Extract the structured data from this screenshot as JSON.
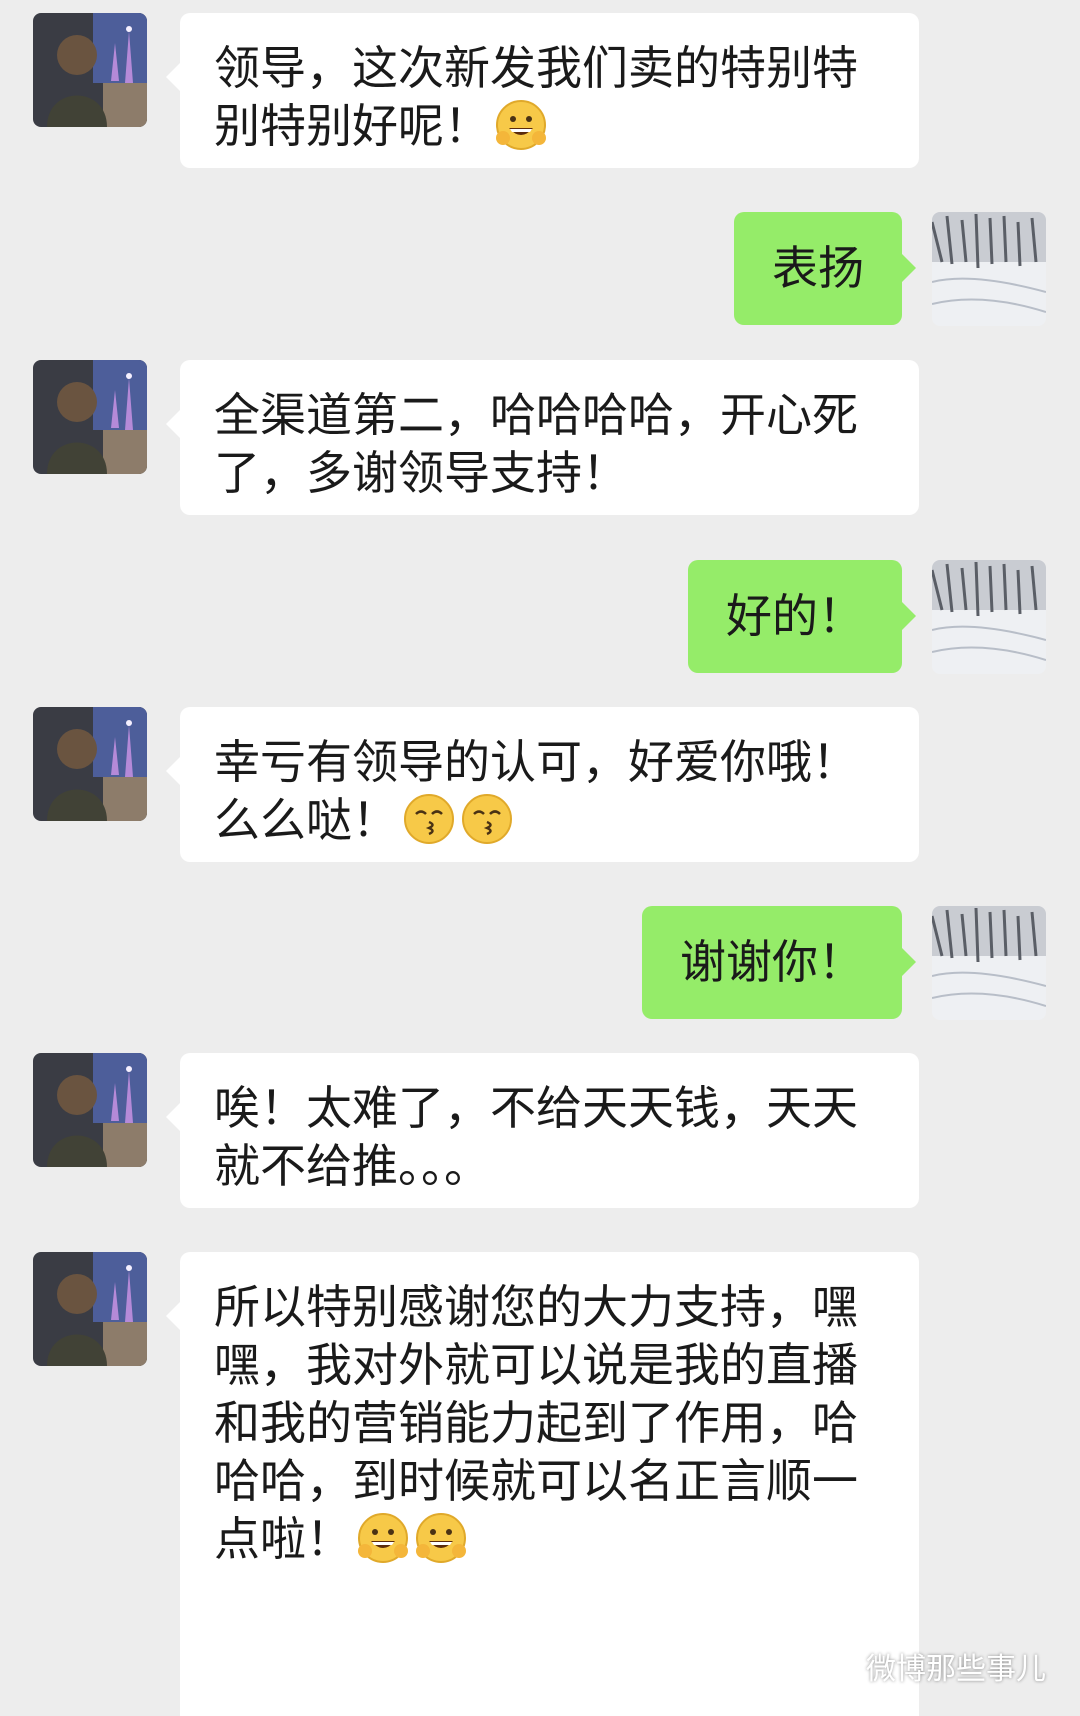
{
  "messages": [
    {
      "side": "in",
      "text": "领导，这次新发我们卖的特别特别特别好呢！",
      "emoji": [
        "grin-hands"
      ]
    },
    {
      "side": "out",
      "text": "表扬"
    },
    {
      "side": "in",
      "text": "全渠道第二，哈哈哈哈，开心死了，多谢领导支持！"
    },
    {
      "side": "out",
      "text": "好的！"
    },
    {
      "side": "in",
      "text": "幸亏有领导的认可，好爱你哦！么么哒！",
      "emoji": [
        "kiss",
        "kiss"
      ]
    },
    {
      "side": "out",
      "text": "谢谢你！"
    },
    {
      "side": "in",
      "text": "唉！太难了，不给天天钱，天天就不给推。。。"
    },
    {
      "side": "in",
      "text": "所以特别感谢您的大力支持，嘿嘿，我对外就可以说是我的直播和我的营销能力起到了作用，哈哈哈，到时候就可以名正言顺一点啦！",
      "emoji": [
        "grin-hands",
        "grin-hands"
      ]
    }
  ],
  "watermark": {
    "text": "微博那些事儿",
    "icon": "weibo-logo-icon"
  }
}
